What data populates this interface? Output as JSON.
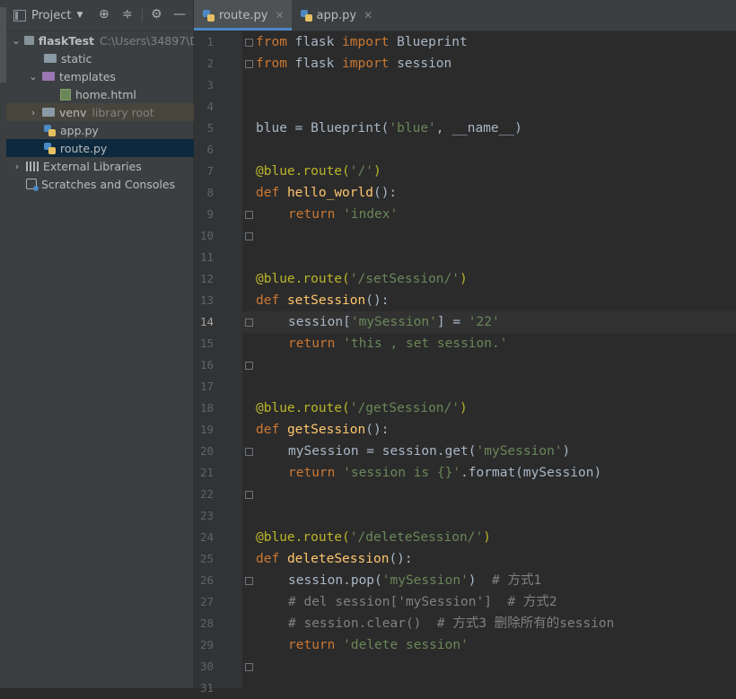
{
  "project_panel": {
    "title": "Project",
    "tree": [
      {
        "label": "flaskTest",
        "hint": "C:\\Users\\34897\\D"
      },
      {
        "label": "static"
      },
      {
        "label": "templates"
      },
      {
        "label": "home.html"
      },
      {
        "label": "venv",
        "hint": "library root"
      },
      {
        "label": "app.py"
      },
      {
        "label": "route.py"
      },
      {
        "label": "External Libraries"
      },
      {
        "label": "Scratches and Consoles"
      }
    ]
  },
  "tabs": [
    {
      "label": "route.py"
    },
    {
      "label": "app.py"
    }
  ],
  "editor": {
    "current_line": 14,
    "line_numbers": [
      "1",
      "2",
      "3",
      "4",
      "5",
      "6",
      "7",
      "8",
      "9",
      "10",
      "11",
      "12",
      "13",
      "14",
      "15",
      "16",
      "17",
      "18",
      "19",
      "20",
      "21",
      "22",
      "23",
      "24",
      "25",
      "26",
      "27",
      "28",
      "29",
      "30",
      "31"
    ]
  },
  "colors": {
    "keyword": "#cc7832",
    "decorator": "#bbb529",
    "string": "#6a8759",
    "function": "#ffc66d",
    "comment": "#808080",
    "text": "#a9b7c6",
    "selection": "#0d293e"
  },
  "icons": [
    "project-icon",
    "crosshair-icon",
    "collapse-icon",
    "gear-icon",
    "minimize-icon",
    "folder-icon",
    "python-file-icon",
    "html-file-icon",
    "library-icon",
    "scratch-icon"
  ]
}
